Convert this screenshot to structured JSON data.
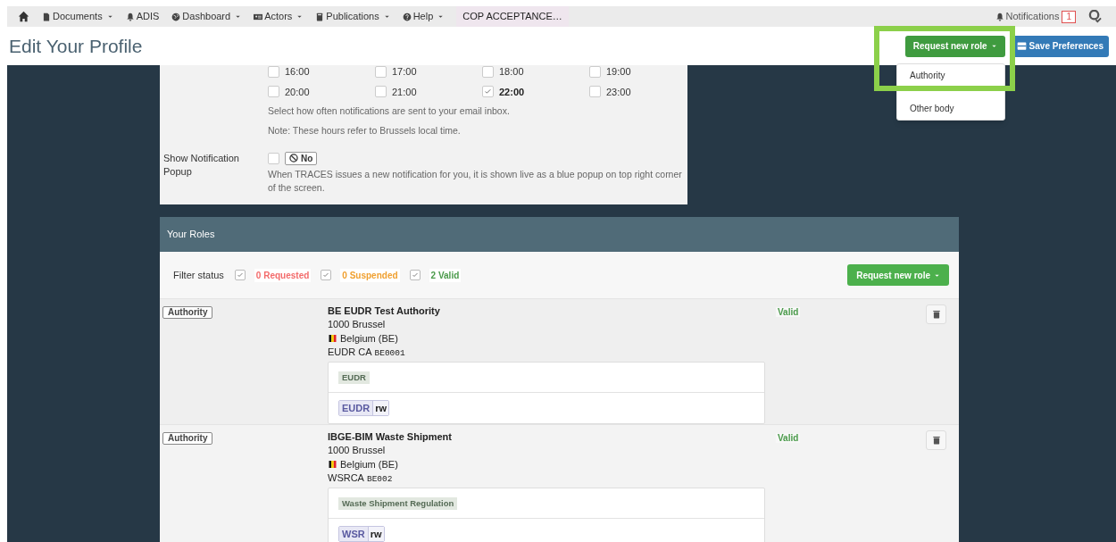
{
  "nav": [
    {
      "label": "Documents",
      "caret": true
    },
    {
      "label": "ADIS",
      "caret": false
    },
    {
      "label": "Dashboard",
      "caret": true
    },
    {
      "label": "Actors",
      "caret": true
    },
    {
      "label": "Publications",
      "caret": true
    },
    {
      "label": "Help",
      "caret": true
    }
  ],
  "environment": "COP ACCEPTANCE…",
  "notifications": {
    "label": "Notifications",
    "count": "1"
  },
  "page_title": "Edit Your Profile",
  "actions": {
    "request_button": "Request new role",
    "save_button": "Save Preferences"
  },
  "dropdown": {
    "items": [
      "Authority",
      "Other body"
    ],
    "highlighted": true
  },
  "hours": [
    {
      "label": "16:00",
      "checked": false
    },
    {
      "label": "17:00",
      "checked": false
    },
    {
      "label": "18:00",
      "checked": false
    },
    {
      "label": "19:00",
      "checked": false
    },
    {
      "label": "20:00",
      "checked": false
    },
    {
      "label": "21:00",
      "checked": false
    },
    {
      "label": "22:00",
      "checked": true
    },
    {
      "label": "23:00",
      "checked": false
    }
  ],
  "hours_help": [
    "Select how often notifications are sent to your email inbox.",
    "Note: These hours refer to Brussels local time."
  ],
  "popup_setting": {
    "label": "Show Notification Popup",
    "checked": false,
    "toggle": "No",
    "help": "When TRACES issues a new notification for you, it is shown live as a blue popup on top right corner of the screen."
  },
  "roles": {
    "title": "Your Roles",
    "filter_label": "Filter status",
    "filters": [
      {
        "label": "0 Requested",
        "checked": true,
        "color": "#f36b6b"
      },
      {
        "label": "0 Suspended",
        "checked": true,
        "color": "#f0a030"
      },
      {
        "label": "2 Valid",
        "checked": true,
        "color": "#4a9a4a"
      }
    ],
    "request_button": "Request new role",
    "items": [
      {
        "type": "Authority",
        "name": "BE EUDR Test Authority",
        "city": "1000 Brussel",
        "country": "Belgium (BE)",
        "code_prefix": "EUDR CA",
        "code": "BE0001",
        "status": "Valid",
        "domain": "EUDR",
        "permission": "EUDR",
        "access": "rw"
      },
      {
        "type": "Authority",
        "name": "IBGE-BIM Waste Shipment",
        "city": "1000 Brussel",
        "country": "Belgium (BE)",
        "code_prefix": "WSRCA",
        "code": "BE002",
        "status": "Valid",
        "domain": "Waste Shipment Regulation",
        "permission": "WSR",
        "access": "rw"
      }
    ]
  }
}
